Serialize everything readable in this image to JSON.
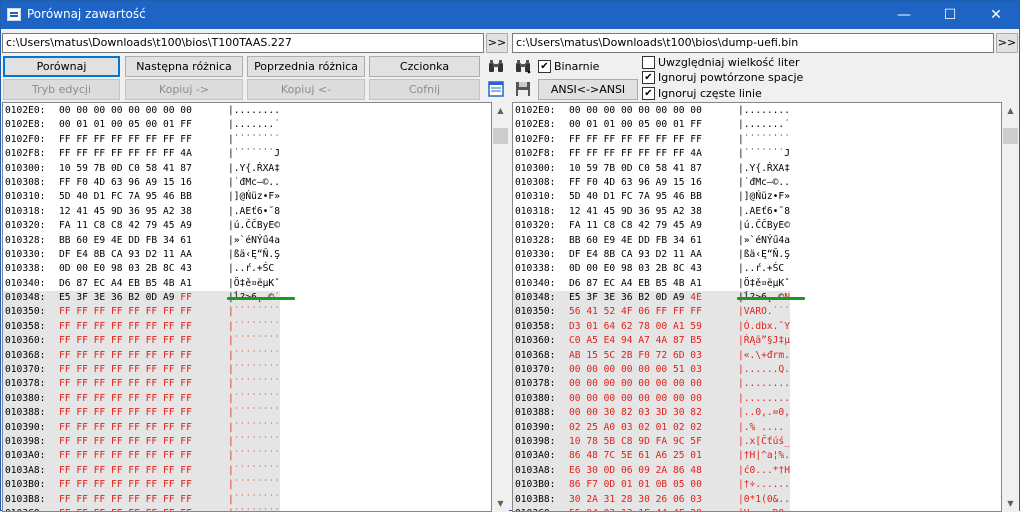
{
  "window": {
    "title": "Porównaj zawartość",
    "minimize": "—",
    "maximize": "☐",
    "close": "✕"
  },
  "paths": {
    "left": "c:\\Users\\matus\\Downloads\\t100\\bios\\T100TAAS.227",
    "right": "c:\\Users\\matus\\Downloads\\t100\\bios\\dump-uefi.bin",
    "browse_label": ">>"
  },
  "toolbar": {
    "compare": "Porównaj",
    "next_diff": "Następna różnica",
    "prev_diff": "Poprzednia różnica",
    "font": "Czcionka",
    "edit_mode": "Tryb edycji",
    "copy_right": "Kopiuj ->",
    "copy_left": "Kopiuj <-",
    "undo": "Cofnij",
    "ansi": "ANSI<->ANSI"
  },
  "icons": {
    "find": "binoculars-icon",
    "find_next": "binoculars-next-icon",
    "view": "window-view-icon",
    "save": "floppy-disk-icon"
  },
  "options": {
    "binary": {
      "label": "Binarnie",
      "checked": true
    },
    "case": {
      "label": "Uwzględniaj wielkość liter",
      "checked": false
    },
    "spaces": {
      "label": "Ignoruj powtórzone spacje",
      "checked": true
    },
    "lines": {
      "label": "Ignoruj częste linie",
      "checked": true
    }
  },
  "colors": {
    "diff_text": "#e0221b",
    "diff_row_bg": "#e5e5e5",
    "marker": "#1a9b1a",
    "titlebar": "#1e64c4"
  },
  "left_rows": [
    {
      "a": "0102E0:",
      "h": "00 00 00 00 00 00 00 00",
      "t": "|........",
      "d": false
    },
    {
      "a": "0102E8:",
      "h": "00 01 01 00 05 00 01 FF",
      "t": "|.......˙",
      "d": false
    },
    {
      "a": "0102F0:",
      "h": "FF FF FF FF FF FF FF FF",
      "t": "|˙˙˙˙˙˙˙˙",
      "d": false
    },
    {
      "a": "0102F8:",
      "h": "FF FF FF FF FF FF FF 4A",
      "t": "|˙˙˙˙˙˙˙J",
      "d": false
    },
    {
      "a": "010300:",
      "h": "10 59 7B 0D C0 58 41 87",
      "t": "|.Y{.ŔXA‡",
      "d": false
    },
    {
      "a": "010308:",
      "h": "FF F0 4D 63 96 A9 15 16",
      "t": "|˙đMc–©..",
      "d": false
    },
    {
      "a": "010310:",
      "h": "5D 40 D1 FC 7A 95 46 BB",
      "t": "|]@Ńüz•F»",
      "d": false
    },
    {
      "a": "010318:",
      "h": "12 41 45 9D 36 95 A2 38",
      "t": "|.AEť6•˘8",
      "d": false
    },
    {
      "a": "010320:",
      "h": "FA 11 C8 C8 42 79 45 A9",
      "t": "|ú.ČČByE©",
      "d": false
    },
    {
      "a": "010328:",
      "h": "BB 60 E9 4E DD FB 34 61",
      "t": "|»`éNÝű4a",
      "d": false
    },
    {
      "a": "010330:",
      "h": "DF E4 8B CA 93 D2 11 AA",
      "t": "|ßä‹Ę“Ň.Ş",
      "d": false
    },
    {
      "a": "010338:",
      "h": "0D 00 E0 98 03 2B 8C 43",
      "t": "|..ŕ.+ŚC",
      "d": false
    },
    {
      "a": "010340:",
      "h": "D6 87 EC A4 EB B5 4B A1",
      "t": "|Ö‡ě¤ëµKˇ",
      "d": false
    },
    {
      "a": "010348:",
      "h": "E5 3F 3E 36 B2 0D A9 FF",
      "t": "|ĺ?>6˛.©˙",
      "d": true,
      "hn": "E5 3F 3E 36 B2 0D A9 ",
      "hr": "FF",
      "tn": "|ĺ?>6˛.©",
      "tr": "˙"
    },
    {
      "a": "010350:",
      "h": "FF FF FF FF FF FF FF FF",
      "t": "|˙˙˙˙˙˙˙˙",
      "d": true
    },
    {
      "a": "010358:",
      "h": "FF FF FF FF FF FF FF FF",
      "t": "|˙˙˙˙˙˙˙˙",
      "d": true
    },
    {
      "a": "010360:",
      "h": "FF FF FF FF FF FF FF FF",
      "t": "|˙˙˙˙˙˙˙˙",
      "d": true
    },
    {
      "a": "010368:",
      "h": "FF FF FF FF FF FF FF FF",
      "t": "|˙˙˙˙˙˙˙˙",
      "d": true
    },
    {
      "a": "010370:",
      "h": "FF FF FF FF FF FF FF FF",
      "t": "|˙˙˙˙˙˙˙˙",
      "d": true
    },
    {
      "a": "010378:",
      "h": "FF FF FF FF FF FF FF FF",
      "t": "|˙˙˙˙˙˙˙˙",
      "d": true
    },
    {
      "a": "010380:",
      "h": "FF FF FF FF FF FF FF FF",
      "t": "|˙˙˙˙˙˙˙˙",
      "d": true
    },
    {
      "a": "010388:",
      "h": "FF FF FF FF FF FF FF FF",
      "t": "|˙˙˙˙˙˙˙˙",
      "d": true
    },
    {
      "a": "010390:",
      "h": "FF FF FF FF FF FF FF FF",
      "t": "|˙˙˙˙˙˙˙˙",
      "d": true
    },
    {
      "a": "010398:",
      "h": "FF FF FF FF FF FF FF FF",
      "t": "|˙˙˙˙˙˙˙˙",
      "d": true
    },
    {
      "a": "0103A0:",
      "h": "FF FF FF FF FF FF FF FF",
      "t": "|˙˙˙˙˙˙˙˙",
      "d": true
    },
    {
      "a": "0103A8:",
      "h": "FF FF FF FF FF FF FF FF",
      "t": "|˙˙˙˙˙˙˙˙",
      "d": true
    },
    {
      "a": "0103B0:",
      "h": "FF FF FF FF FF FF FF FF",
      "t": "|˙˙˙˙˙˙˙˙",
      "d": true
    },
    {
      "a": "0103B8:",
      "h": "FF FF FF FF FF FF FF FF",
      "t": "|˙˙˙˙˙˙˙˙",
      "d": true
    },
    {
      "a": "0103C0:",
      "h": "FF FF FF FF FF FF FF FF",
      "t": "|˙˙˙˙˙˙˙˙",
      "d": true
    }
  ],
  "right_rows": [
    {
      "a": "0102E0:",
      "h": "00 00 00 00 00 00 00 00",
      "t": "|........",
      "d": false
    },
    {
      "a": "0102E8:",
      "h": "00 01 01 00 05 00 01 FF",
      "t": "|.......˙",
      "d": false
    },
    {
      "a": "0102F0:",
      "h": "FF FF FF FF FF FF FF FF",
      "t": "|˙˙˙˙˙˙˙˙",
      "d": false
    },
    {
      "a": "0102F8:",
      "h": "FF FF FF FF FF FF FF 4A",
      "t": "|˙˙˙˙˙˙˙J",
      "d": false
    },
    {
      "a": "010300:",
      "h": "10 59 7B 0D C0 58 41 87",
      "t": "|.Y{.ŔXA‡",
      "d": false
    },
    {
      "a": "010308:",
      "h": "FF F0 4D 63 96 A9 15 16",
      "t": "|˙đMc–©..",
      "d": false
    },
    {
      "a": "010310:",
      "h": "5D 40 D1 FC 7A 95 46 BB",
      "t": "|]@Ńüz•F»",
      "d": false
    },
    {
      "a": "010318:",
      "h": "12 41 45 9D 36 95 A2 38",
      "t": "|.AEť6•˘8",
      "d": false
    },
    {
      "a": "010320:",
      "h": "FA 11 C8 C8 42 79 45 A9",
      "t": "|ú.ČČByE©",
      "d": false
    },
    {
      "a": "010328:",
      "h": "BB 60 E9 4E DD FB 34 61",
      "t": "|»`éNÝű4a",
      "d": false
    },
    {
      "a": "010330:",
      "h": "DF E4 8B CA 93 D2 11 AA",
      "t": "|ßä‹Ę“Ň.Ş",
      "d": false
    },
    {
      "a": "010338:",
      "h": "0D 00 E0 98 03 2B 8C 43",
      "t": "|..ŕ.+ŚC",
      "d": false
    },
    {
      "a": "010340:",
      "h": "D6 87 EC A4 EB B5 4B A1",
      "t": "|Ö‡ě¤ëµKˇ",
      "d": false
    },
    {
      "a": "010348:",
      "h": "E5 3F 3E 36 B2 0D A9 4E",
      "t": "|ĺ?>6˛.©N",
      "d": true,
      "hn": "E5 3F 3E 36 B2 0D A9 ",
      "hr": "4E",
      "tn": "|ĺ?>6˛.©",
      "tr": "N"
    },
    {
      "a": "010350:",
      "h": "56 41 52 4F 06 FF FF FF",
      "t": "|VARO.˙˙˙",
      "d": true
    },
    {
      "a": "010358:",
      "h": "D3 01 64 62 78 00 A1 59",
      "t": "|Ó.dbx.ˇY",
      "d": true
    },
    {
      "a": "010360:",
      "h": "C0 A5 E4 94 A7 4A 87 B5",
      "t": "|ŔĄä”§J‡µ",
      "d": true
    },
    {
      "a": "010368:",
      "h": "AB 15 5C 2B F0 72 6D 03",
      "t": "|«.\\+đrm.",
      "d": true
    },
    {
      "a": "010370:",
      "h": "00 00 00 00 00 00 51 03",
      "t": "|......Q.",
      "d": true
    },
    {
      "a": "010378:",
      "h": "00 00 00 00 00 00 00 00",
      "t": "|........",
      "d": true
    },
    {
      "a": "010380:",
      "h": "00 00 00 00 00 00 00 00",
      "t": "|........",
      "d": true
    },
    {
      "a": "010388:",
      "h": "00 00 30 82 03 3D 30 82",
      "t": "|..0‚.=0‚",
      "d": true
    },
    {
      "a": "010390:",
      "h": "02 25 A0 03 02 01 02 02",
      "t": "|.% ....",
      "d": true
    },
    {
      "a": "010398:",
      "h": "10 78 5B C8 9D FA 9C 5F",
      "t": "|.x[Čťúś_",
      "d": true
    },
    {
      "a": "0103A0:",
      "h": "86 48 7C 5E 61 A6 25 01",
      "t": "|†H|^a¦%.",
      "d": true
    },
    {
      "a": "0103A8:",
      "h": "E6 30 0D 06 09 2A 86 48",
      "t": "|ć0...*†H",
      "d": true
    },
    {
      "a": "0103B0:",
      "h": "86 F7 0D 01 01 0B 05 00",
      "t": "|†÷......",
      "d": true
    },
    {
      "a": "0103B8:",
      "h": "30 2A 31 28 30 26 06 03",
      "t": "|0*1(0&..",
      "d": true
    },
    {
      "a": "0103C0:",
      "h": "55 04 03 13 1F 44 4F 20",
      "t": "|U....DO ",
      "d": true
    }
  ]
}
